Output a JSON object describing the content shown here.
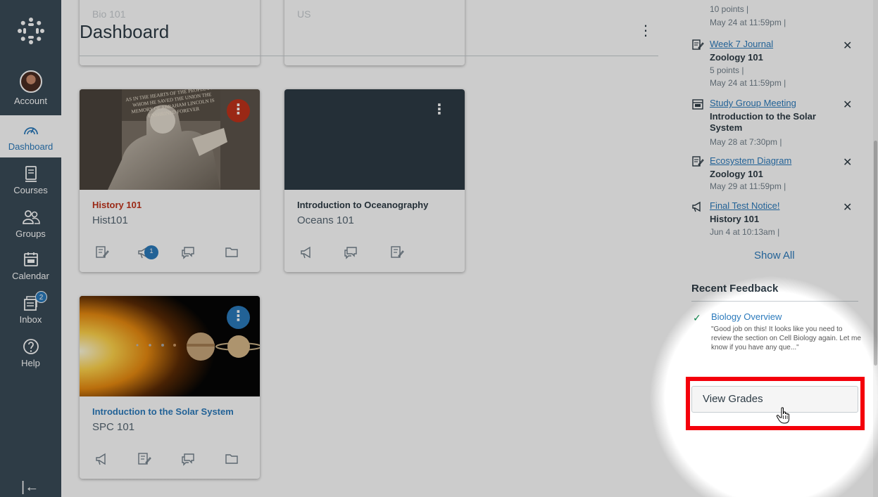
{
  "nav": {
    "items": [
      {
        "label": "Account"
      },
      {
        "label": "Dashboard"
      },
      {
        "label": "Courses"
      },
      {
        "label": "Groups"
      },
      {
        "label": "Calendar"
      },
      {
        "label": "Inbox",
        "badge": "2"
      },
      {
        "label": "Help"
      }
    ],
    "collapse_glyph": "|←"
  },
  "header": {
    "title": "Dashboard",
    "menu_glyph": "⋮"
  },
  "cards": [
    {
      "name": "History 101",
      "code": "Hist101",
      "color": "#c1321a",
      "menu_glyph": "⋮",
      "hero_caption": "AS IN THE HEARTS OF THE PEOPLE FOR WHOM HE SAVED THE UNION THE MEMORY OF ABRAHAM LINCOLN IS ENSHRINED FOREVER",
      "icons": [
        "assignments-icon",
        "announcements-icon",
        "discussions-icon",
        "files-icon"
      ],
      "announcement_badge": "1"
    },
    {
      "name": "Introduction to Oceanography",
      "code": "Oceans 101",
      "color": "#2d3b45",
      "menu_glyph": "⋮",
      "icons": [
        "announcements-icon",
        "discussions-icon",
        "assignments-icon"
      ]
    },
    {
      "name": "Introduction to the Solar System",
      "code": "SPC 101",
      "color": "#2b7abc",
      "menu_glyph": "⋮",
      "icons": [
        "announcements-icon",
        "assignments-icon",
        "discussions-icon",
        "files-icon"
      ]
    }
  ],
  "top_cards": [
    {
      "code": "Bio 101"
    },
    {
      "code": "US"
    }
  ],
  "todo": {
    "first_meta": [
      "10 points |",
      "May 24 at 11:59pm |"
    ],
    "items": [
      {
        "title": "Week 7 Journal",
        "course": "Zoology 101",
        "meta": [
          "5 points |",
          "May 24 at 11:59pm |"
        ],
        "icon": "assignment-icon"
      },
      {
        "title": "Study Group Meeting",
        "course": "Introduction to the Solar System",
        "meta": [
          "May 28 at 7:30pm |"
        ],
        "icon": "calendar-event-icon"
      },
      {
        "title": "Ecosystem Diagram",
        "course": "Zoology 101",
        "meta": [
          "May 29 at 11:59pm |"
        ],
        "icon": "assignment-icon"
      },
      {
        "title": "Final Test Notice!",
        "course": "History 101",
        "meta": [
          "Jun 4 at 10:13am |"
        ],
        "icon": "announcement-icon"
      }
    ],
    "close_glyph": "✕",
    "show_all": "Show All"
  },
  "feedback": {
    "heading": "Recent Feedback",
    "check_glyph": "✓",
    "title": "Biology Overview",
    "comment": "\"Good job on this! It looks like you need to review the section on Cell Biology again. Let me know if you have any que...\"",
    "view_grades": "View Grades"
  },
  "colors": {
    "nav_bg": "#394b58",
    "link": "#2b7abc",
    "highlight": "#f4000b"
  }
}
